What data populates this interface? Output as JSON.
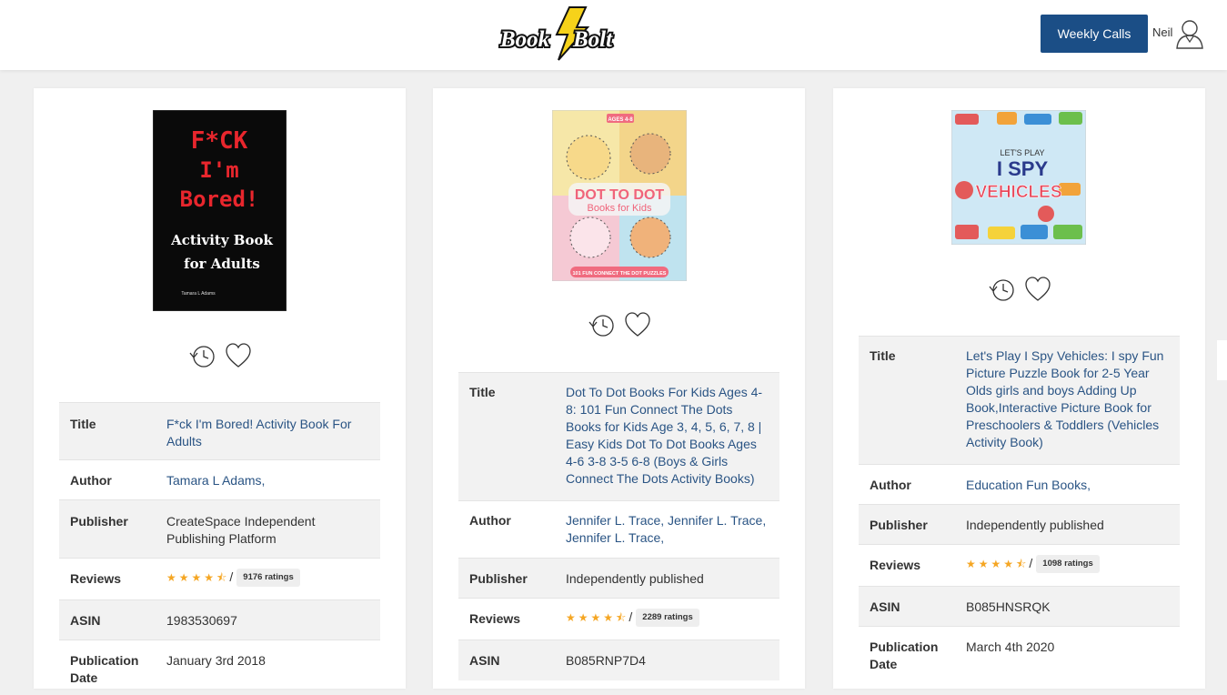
{
  "header": {
    "logo_text_left": "Book",
    "logo_text_right": "Bolt",
    "weekly_calls_label": "Weekly Calls",
    "user_name": "Neil"
  },
  "labels": {
    "title": "Title",
    "author": "Author",
    "publisher": "Publisher",
    "reviews": "Reviews",
    "asin": "ASIN",
    "publication_date": "Publication Date"
  },
  "books": [
    {
      "cover_text": [
        "F*CK",
        "I'm",
        "Bored!",
        "Activity Book",
        "for Adults",
        "Tamara L Adams"
      ],
      "title": "F*ck I'm Bored! Activity Book For Adults",
      "author": "Tamara L Adams,",
      "publisher": "CreateSpace Independent Publishing Platform",
      "rating_stars": 4.5,
      "ratings": "9176 ratings",
      "asin": "1983530697",
      "publication_date": "January 3rd 2018"
    },
    {
      "cover_text": [
        "AGES 4-8",
        "DOT TO DOT",
        "Books for Kids",
        "101 FUN CONNECT THE DOT PUZZLES"
      ],
      "title": "Dot To Dot Books For Kids Ages 4-8: 101 Fun Connect The Dots Books for Kids Age 3, 4, 5, 6, 7, 8 | Easy Kids Dot To Dot Books Ages 4-6 3-8 3-5 6-8 (Boys & Girls Connect The Dots Activity Books)",
      "author": "Jennifer L. Trace, Jennifer L. Trace, Jennifer L. Trace,",
      "publisher": "Independently published",
      "rating_stars": 4.5,
      "ratings": "2289 ratings",
      "asin": "B085RNP7D4"
    },
    {
      "cover_text": [
        "LET'S PLAY",
        "I SPY",
        "VEHICLES"
      ],
      "title": "Let's Play I Spy Vehicles: I spy Fun Picture Puzzle Book for 2-5 Year Olds girls and boys Adding Up Book,Interactive Picture Book for Preschoolers & Toddlers (Vehicles Activity Book)",
      "author": "Education Fun Books,",
      "publisher": "Independently published",
      "rating_stars": 4.5,
      "ratings": "1098 ratings",
      "asin": "B085HNSRQK",
      "publication_date": "March 4th 2020"
    }
  ],
  "stars_glyph": "★★★★⯪",
  "slash": "/",
  "colors": {
    "brand_blue": "#1b4e86",
    "link_blue": "#2a5484",
    "star": "#f5a623"
  }
}
